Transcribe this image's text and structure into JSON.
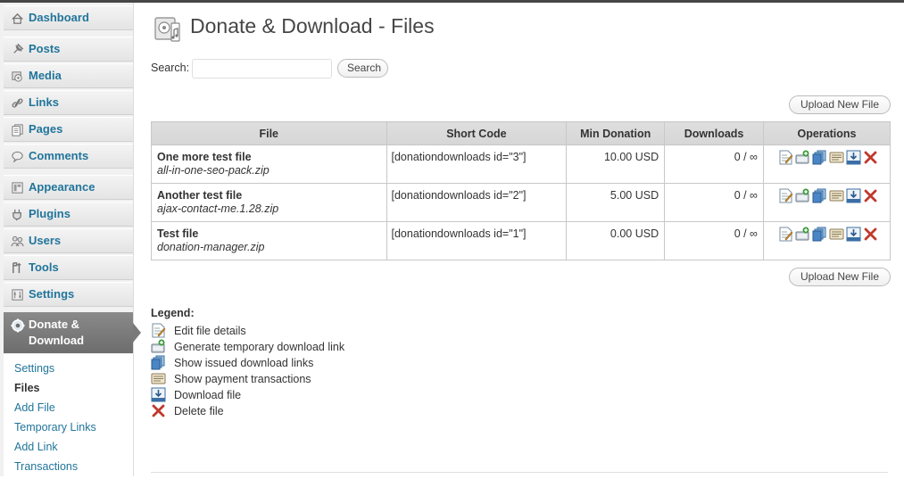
{
  "sidebar": {
    "items": [
      {
        "label": "Dashboard",
        "icon": "dashboard-icon"
      },
      {
        "label": "Posts",
        "icon": "pin-icon"
      },
      {
        "label": "Media",
        "icon": "media-icon"
      },
      {
        "label": "Links",
        "icon": "link-icon"
      },
      {
        "label": "Pages",
        "icon": "pages-icon"
      },
      {
        "label": "Comments",
        "icon": "comment-icon"
      },
      {
        "label": "Appearance",
        "icon": "appearance-icon"
      },
      {
        "label": "Plugins",
        "icon": "plugin-icon"
      },
      {
        "label": "Users",
        "icon": "users-icon"
      },
      {
        "label": "Tools",
        "icon": "tools-icon"
      },
      {
        "label": "Settings",
        "icon": "settings-icon"
      }
    ],
    "active": {
      "label": "Donate & Download",
      "icon": "gear-icon"
    },
    "submenu": [
      {
        "label": "Settings"
      },
      {
        "label": "Files",
        "current": true
      },
      {
        "label": "Add File"
      },
      {
        "label": "Temporary Links"
      },
      {
        "label": "Add Link"
      },
      {
        "label": "Transactions"
      }
    ]
  },
  "header": {
    "title": "Donate & Download - Files",
    "icon": "media-file-icon"
  },
  "search": {
    "label": "Search:",
    "placeholder": "",
    "value": "",
    "button": "Search"
  },
  "upload_button": "Upload New File",
  "table": {
    "columns": [
      "File",
      "Short Code",
      "Min Donation",
      "Downloads",
      "Operations"
    ],
    "rows": [
      {
        "name": "One more test file",
        "filename": "all-in-one-seo-pack.zip",
        "shortcode": "[donationdownloads id=\"3\"]",
        "min_donation": "10.00 USD",
        "downloads": "0 / ∞"
      },
      {
        "name": "Another test file",
        "filename": "ajax-contact-me.1.28.zip",
        "shortcode": "[donationdownloads id=\"2\"]",
        "min_donation": "5.00 USD",
        "downloads": "0 / ∞"
      },
      {
        "name": "Test file",
        "filename": "donation-manager.zip",
        "shortcode": "[donationdownloads id=\"1\"]",
        "min_donation": "0.00 USD",
        "downloads": "0 / ∞"
      }
    ],
    "operations": [
      "edit-icon",
      "generate-link-icon",
      "issued-links-icon",
      "transactions-icon",
      "download-icon",
      "delete-icon"
    ]
  },
  "legend": {
    "title": "Legend:",
    "items": [
      {
        "icon": "edit-icon",
        "text": "Edit file details"
      },
      {
        "icon": "generate-link-icon",
        "text": "Generate temporary download link"
      },
      {
        "icon": "issued-links-icon",
        "text": "Show issued download links"
      },
      {
        "icon": "transactions-icon",
        "text": "Show payment transactions"
      },
      {
        "icon": "download-icon",
        "text": "Download file"
      },
      {
        "icon": "delete-icon",
        "text": "Delete file"
      }
    ]
  },
  "colors": {
    "link": "#21759b",
    "active_menu": "#7a7a7a",
    "delete": "#c0392b"
  }
}
